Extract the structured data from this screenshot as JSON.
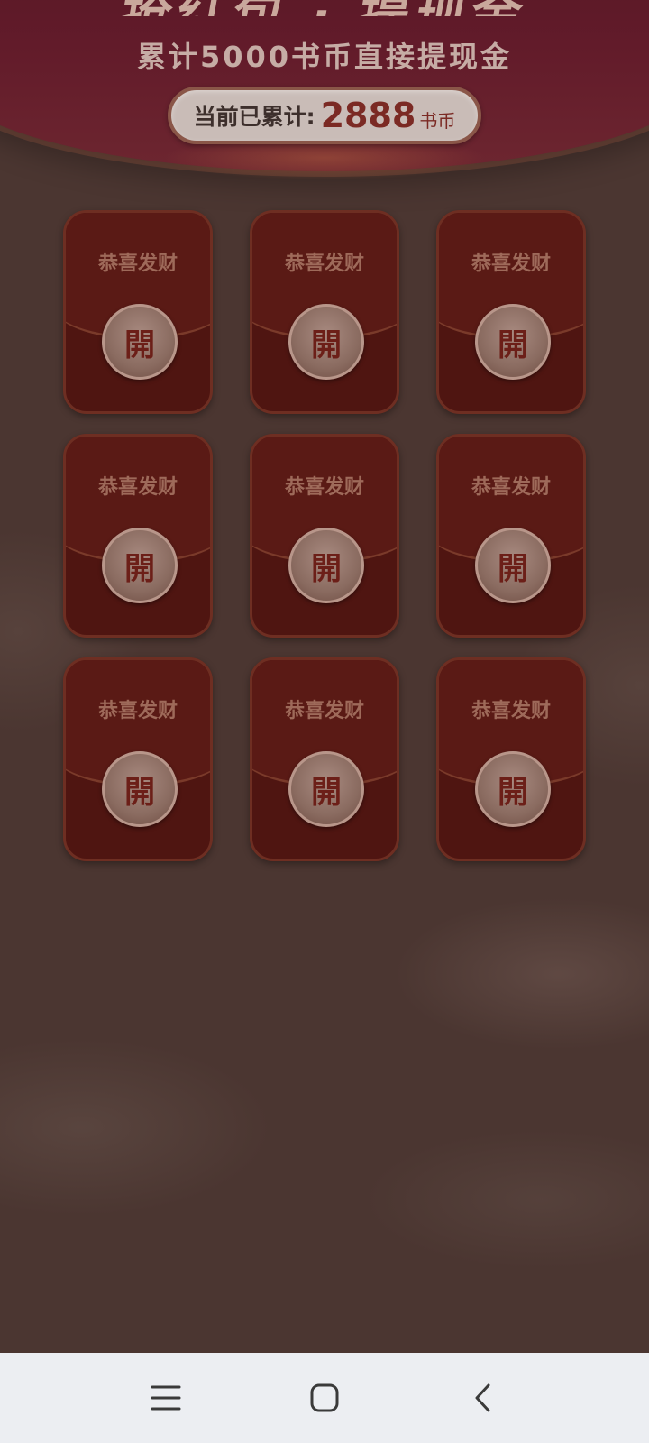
{
  "header": {
    "headline": "抢红包 · 提现金",
    "subtitle": "累计5000书币直接提现金",
    "counter_label": "当前已累计:",
    "counter_value": "2888",
    "counter_unit": "书币"
  },
  "envelopes": [
    {
      "greeting": "恭喜发财",
      "open_label": "開"
    },
    {
      "greeting": "恭喜发财",
      "open_label": "開"
    },
    {
      "greeting": "恭喜发财",
      "open_label": "開"
    },
    {
      "greeting": "恭喜发财",
      "open_label": "開"
    },
    {
      "greeting": "恭喜发财",
      "open_label": "開"
    },
    {
      "greeting": "恭喜发财",
      "open_label": "開"
    },
    {
      "greeting": "恭喜发财",
      "open_label": "開"
    },
    {
      "greeting": "恭喜发财",
      "open_label": "開"
    },
    {
      "greeting": "恭喜发财",
      "open_label": "開"
    }
  ],
  "navbar": {
    "menu_icon": "menu-icon",
    "home_icon": "home-icon",
    "back_icon": "back-icon"
  },
  "colors": {
    "overlay_bg": "#4b3631",
    "envelope": "#5a1a15",
    "accent_text": "#7b2a24",
    "navbar_bg": "#eceef2"
  }
}
